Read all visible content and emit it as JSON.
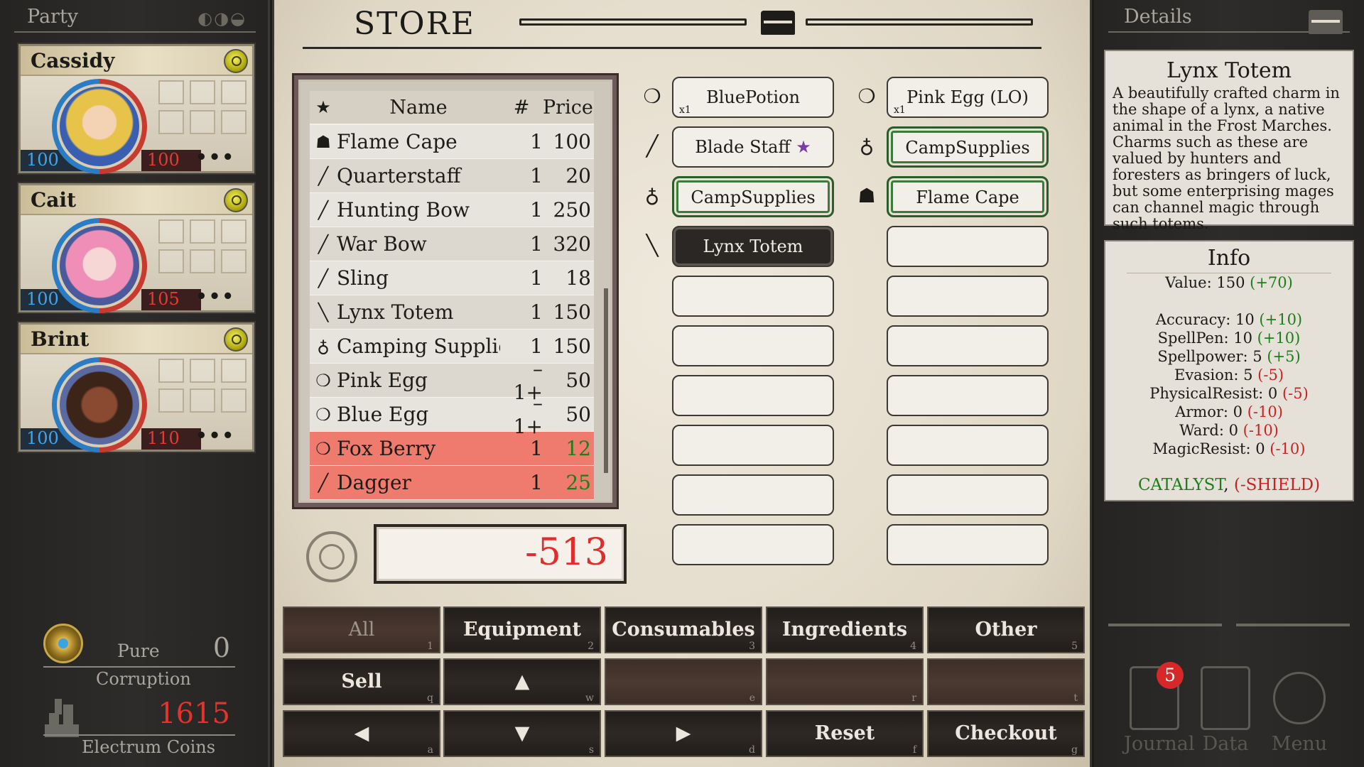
{
  "party": {
    "header": "Party",
    "members": [
      {
        "name": "Cassidy",
        "hp": "100",
        "mp": "100",
        "more": "•••"
      },
      {
        "name": "Cait",
        "hp": "100",
        "mp": "105",
        "more": "•••"
      },
      {
        "name": "Brint",
        "hp": "100",
        "mp": "110",
        "more": "•••"
      }
    ],
    "status": {
      "pure_label": "Pure",
      "pure_value": "0",
      "corruption_label": "Corruption",
      "coins_value": "1615",
      "coins_label": "Electrum Coins"
    }
  },
  "store": {
    "title": "STORE",
    "table": {
      "header": {
        "star": "★",
        "name": "Name",
        "qty": "#",
        "price": "Price"
      },
      "rows": [
        {
          "icon": "cape-icon",
          "glyph": "☗",
          "name": "Flame Cape",
          "qty": "1",
          "price": "100",
          "selected": false
        },
        {
          "icon": "staff-icon",
          "glyph": "╱",
          "name": "Quarterstaff",
          "qty": "1",
          "price": "20",
          "selected": false
        },
        {
          "icon": "bow-icon",
          "glyph": "╱",
          "name": "Hunting Bow",
          "qty": "1",
          "price": "250",
          "selected": false
        },
        {
          "icon": "bow-icon",
          "glyph": "╱",
          "name": "War Bow",
          "qty": "1",
          "price": "320",
          "selected": false
        },
        {
          "icon": "sling-icon",
          "glyph": "╱",
          "name": "Sling",
          "qty": "1",
          "price": "18",
          "selected": false
        },
        {
          "icon": "totem-icon",
          "glyph": "╲",
          "name": "Lynx Totem",
          "qty": "1",
          "price": "150",
          "selected": false
        },
        {
          "icon": "bag-icon",
          "glyph": "♁",
          "name": "Camping Supplie:",
          "qty": "1",
          "price": "150",
          "selected": false
        },
        {
          "icon": "egg-icon",
          "glyph": "❍",
          "name": "Pink Egg",
          "qty": "– 1+",
          "price": "50",
          "selected": false
        },
        {
          "icon": "egg-icon",
          "glyph": "❍",
          "name": "Blue Egg",
          "qty": "– 1+",
          "price": "50",
          "selected": false
        },
        {
          "icon": "berry-icon",
          "glyph": "❍",
          "name": "Fox Berry",
          "qty": "1",
          "price": "12",
          "selected": true
        },
        {
          "icon": "dagger-icon",
          "glyph": "╱",
          "name": "Dagger",
          "qty": "1",
          "price": "25",
          "selected": true
        }
      ]
    },
    "total": "-513",
    "cart_left": [
      {
        "label": "BluePotion",
        "qty": "x1",
        "style": "normal",
        "glyph": "❍"
      },
      {
        "label": "Blade Staff",
        "star": "★",
        "style": "normal",
        "glyph": "╱"
      },
      {
        "label": "CampSupplies",
        "style": "green",
        "glyph": "♁"
      },
      {
        "label": "Lynx Totem",
        "style": "dark",
        "glyph": "╲"
      }
    ],
    "cart_right": [
      {
        "label": "Pink Egg (LO)",
        "qty": "x1",
        "style": "normal",
        "glyph": "❍"
      },
      {
        "label": "CampSupplies",
        "style": "green",
        "glyph": "♁"
      },
      {
        "label": "Flame Cape",
        "style": "green",
        "glyph": "☗"
      }
    ],
    "tabs": [
      {
        "label": "All",
        "key": "1",
        "active": true
      },
      {
        "label": "Equipment",
        "key": "2"
      },
      {
        "label": "Consumables",
        "key": "3"
      },
      {
        "label": "Ingredients",
        "key": "4"
      },
      {
        "label": "Other",
        "key": "5"
      }
    ],
    "actions": {
      "sell": {
        "label": "Sell",
        "key": "q"
      },
      "up": {
        "label": "▲",
        "key": "w"
      },
      "empty_e": {
        "key": "e"
      },
      "empty_r": {
        "key": "r"
      },
      "empty_t": {
        "key": "t"
      },
      "left": {
        "label": "◀",
        "key": "a"
      },
      "down": {
        "label": "▼",
        "key": "s"
      },
      "right": {
        "label": "▶",
        "key": "d"
      },
      "reset": {
        "label": "Reset",
        "key": "f"
      },
      "checkout": {
        "label": "Checkout",
        "key": "g"
      }
    }
  },
  "details": {
    "header": "Details",
    "item_title": "Lynx Totem",
    "description": "A beautifully crafted charm in the shape of a lynx, a native animal in the Frost Marches. Charms such as these are valued by hunters and foresters as bringers of luck, but some enterprising mages can channel magic through such totems.",
    "info_title": "Info",
    "value": {
      "label": "Value: 150",
      "delta": "(+70)"
    },
    "stats": [
      {
        "label": "Accuracy: 10",
        "delta": "(+10)",
        "positive": true
      },
      {
        "label": "SpellPen: 10",
        "delta": "(+10)",
        "positive": true
      },
      {
        "label": "Spellpower: 5",
        "delta": "(+5)",
        "positive": true
      },
      {
        "label": "Evasion: 5",
        "delta": "(-5)",
        "positive": false
      },
      {
        "label": "PhysicalResist: 0",
        "delta": "(-5)",
        "positive": false
      },
      {
        "label": "Armor: 0",
        "delta": "(-10)",
        "positive": false
      },
      {
        "label": "Ward: 0",
        "delta": "(-10)",
        "positive": false
      },
      {
        "label": "MagicResist: 0",
        "delta": "(-10)",
        "positive": false
      }
    ],
    "tag_positive": "CATALYST",
    "tag_separator": ",",
    "tag_negative": "(-SHIELD)"
  },
  "menu": {
    "journal": "Journal",
    "journal_badge": "5",
    "data": "Data",
    "menu": "Menu"
  },
  "colors": {
    "accent_red": "#e22c2c",
    "positive_green": "#1d7d1a",
    "selected_row": "#ee7b6e"
  }
}
